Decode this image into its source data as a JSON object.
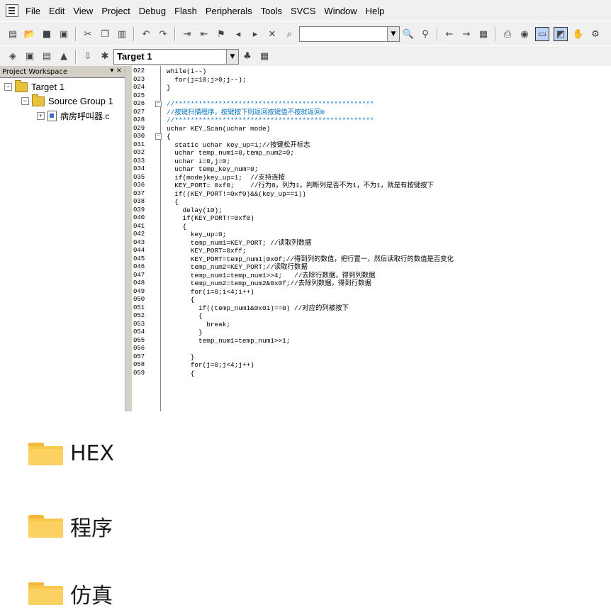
{
  "menubar": {
    "items": [
      "File",
      "Edit",
      "View",
      "Project",
      "Debug",
      "Flash",
      "Peripherals",
      "Tools",
      "SVCS",
      "Window",
      "Help"
    ]
  },
  "toolbar2": {
    "target_combo": "Target 1"
  },
  "workspace": {
    "title": "Project Workspace",
    "close": "▾ ×",
    "tree": {
      "target": "Target 1",
      "group": "Source Group 1",
      "file": "病房呼叫器.c"
    }
  },
  "editor": {
    "lines": [
      {
        "n": "022",
        "code": "while(i--)"
      },
      {
        "n": "023",
        "code": "  for(j=10;j>0;j--);"
      },
      {
        "n": "024",
        "code": "}"
      },
      {
        "n": "025",
        "code": ""
      },
      {
        "n": "026",
        "code": "//**************************************************"
      },
      {
        "n": "027",
        "code": "//按键扫描程序，按键按下则返回按键值不按就返回0"
      },
      {
        "n": "028",
        "code": "//**************************************************"
      },
      {
        "n": "029",
        "code": "uchar KEY_Scan(uchar mode)"
      },
      {
        "n": "030",
        "code": "{"
      },
      {
        "n": "031",
        "code": "  static uchar key_up=1;//按键松开标志"
      },
      {
        "n": "032",
        "code": "  uchar temp_num1=0,temp_num2=0;"
      },
      {
        "n": "033",
        "code": "  uchar i=0,j=0;"
      },
      {
        "n": "034",
        "code": "  uchar temp_key_num=0;"
      },
      {
        "n": "035",
        "code": "  if(mode)key_up=1;  //支持连按"
      },
      {
        "n": "036",
        "code": "  KEY_PORT= 0xf0;    //行为0，列为1，判断列是否不为1，不为1，就是有按键按下"
      },
      {
        "n": "037",
        "code": "  if((KEY_PORT!=0xf0)&&(key_up==1))"
      },
      {
        "n": "038",
        "code": "  {"
      },
      {
        "n": "039",
        "code": "    delay(10);"
      },
      {
        "n": "040",
        "code": "    if(KEY_PORT!=0xf0)"
      },
      {
        "n": "041",
        "code": "    {"
      },
      {
        "n": "042",
        "code": "      key_up=0;"
      },
      {
        "n": "043",
        "code": "      temp_num1=KEY_PORT; //读取列数据"
      },
      {
        "n": "044",
        "code": "      KEY_PORT=0xff;"
      },
      {
        "n": "045",
        "code": "      KEY_PORT=temp_num1|0x0f;//得到列的数值，把行置一，然后读取行的数值是否变化"
      },
      {
        "n": "046",
        "code": "      temp_num2=KEY_PORT;//读取行数据"
      },
      {
        "n": "047",
        "code": "      temp_num1=temp_num1>>4;   //去除行数据，得到列数据"
      },
      {
        "n": "048",
        "code": "      temp_num2=temp_num2&0x0f;//去除列数据，得到行数据"
      },
      {
        "n": "049",
        "code": "      for(i=0;i<4;i++)"
      },
      {
        "n": "050",
        "code": "      {"
      },
      {
        "n": "051",
        "code": "        if((temp_num1&0x01)==0) //对应的列被按下"
      },
      {
        "n": "052",
        "code": "        {"
      },
      {
        "n": "053",
        "code": "          break;"
      },
      {
        "n": "054",
        "code": "        }"
      },
      {
        "n": "055",
        "code": "        temp_num1=temp_num1>>1;"
      },
      {
        "n": "056",
        "code": ""
      },
      {
        "n": "057",
        "code": "      }"
      },
      {
        "n": "058",
        "code": "      for(j=0;j<4;j++)"
      },
      {
        "n": "059",
        "code": "      {"
      }
    ]
  },
  "desktop": {
    "folders": [
      "HEX",
      "程序",
      "仿真"
    ]
  },
  "colors": {
    "folder": "#f8c84a",
    "comment": "#0070c0",
    "number": "#e02020"
  }
}
